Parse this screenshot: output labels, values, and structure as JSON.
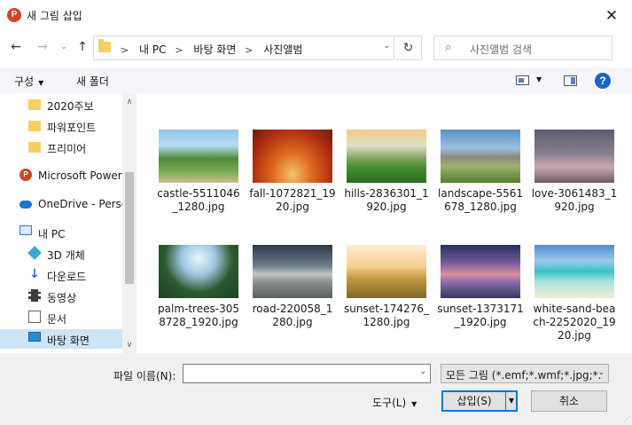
{
  "window": {
    "app_icon": "P",
    "title": "새 그림 삽입",
    "close_glyph": "✕"
  },
  "addressbar": {
    "back_glyph": "←",
    "forward_glyph": "→",
    "recent_glyph": "⌄",
    "up_glyph": "↑",
    "crumbs": [
      "내 PC",
      "바탕 화면",
      "사진앨범"
    ],
    "crumb_sep": ">",
    "dropdown_glyph": "⌄",
    "refresh_glyph": "↻",
    "search_placeholder": "사진앨범 검색",
    "search_glyph": "⌕"
  },
  "commandbar": {
    "organize": "구성",
    "organize_caret": "▼",
    "new_folder": "새 폴더",
    "view_caret": "▼",
    "help_glyph": "?"
  },
  "navpane": {
    "items": [
      {
        "label": "2020주보",
        "icon": "folder-icon",
        "indent": 2
      },
      {
        "label": "파워포인트",
        "icon": "folder-icon",
        "indent": 2
      },
      {
        "label": "프리미어",
        "icon": "folder-icon",
        "indent": 2
      },
      {
        "label": "Microsoft PowerP",
        "icon": "powerpoint-icon",
        "indent": 1
      },
      {
        "label": "OneDrive - Person",
        "icon": "onedrive-icon",
        "indent": 1
      },
      {
        "label": "내 PC",
        "icon": "pc-icon",
        "indent": 1
      },
      {
        "label": "3D 개체",
        "icon": "3d-objects-icon",
        "indent": 2
      },
      {
        "label": "다운로드",
        "icon": "download-icon",
        "indent": 2
      },
      {
        "label": "동영상",
        "icon": "video-icon",
        "indent": 2
      },
      {
        "label": "문서",
        "icon": "document-icon",
        "indent": 2
      },
      {
        "label": "바탕 화면",
        "icon": "desktop-icon",
        "indent": 2,
        "selected": true
      }
    ],
    "scroll_up_glyph": "∧",
    "scroll_down_glyph": "∨"
  },
  "files": [
    {
      "name": "castle-5511046_1280.jpg",
      "thumb": "castle"
    },
    {
      "name": "fall-1072821_1920.jpg",
      "thumb": "fall"
    },
    {
      "name": "hills-2836301_1920.jpg",
      "thumb": "hills"
    },
    {
      "name": "landscape-5561678_1280.jpg",
      "thumb": "landscape"
    },
    {
      "name": "love-3061483_1920.jpg",
      "thumb": "love"
    },
    {
      "name": "palm-trees-3058728_1920.jpg",
      "thumb": "palm"
    },
    {
      "name": "road-220058_1280.jpg",
      "thumb": "road"
    },
    {
      "name": "sunset-174276_1280.jpg",
      "thumb": "sunset1"
    },
    {
      "name": "sunset-1373171_1920.jpg",
      "thumb": "sunset2"
    },
    {
      "name": "white-sand-beach-2252020_1920.jpg",
      "thumb": "beach"
    }
  ],
  "bottom": {
    "filename_label": "파일 이름(N):",
    "filename_value": "",
    "filename_dropdown_glyph": "⌄",
    "filetype": "모든 그림 (*.emf;*.wmf;*.jpg;*.",
    "filetype_dropdown_glyph": "⌄",
    "tools": "도구(L)",
    "tools_caret": "▼",
    "insert": "삽입(S)",
    "insert_caret": "▼",
    "cancel": "취소"
  },
  "colors": {
    "accent": "#0078d7",
    "selected_bg": "#cce4f7",
    "folder": "#f5cf60",
    "help": "#1d63c6"
  }
}
